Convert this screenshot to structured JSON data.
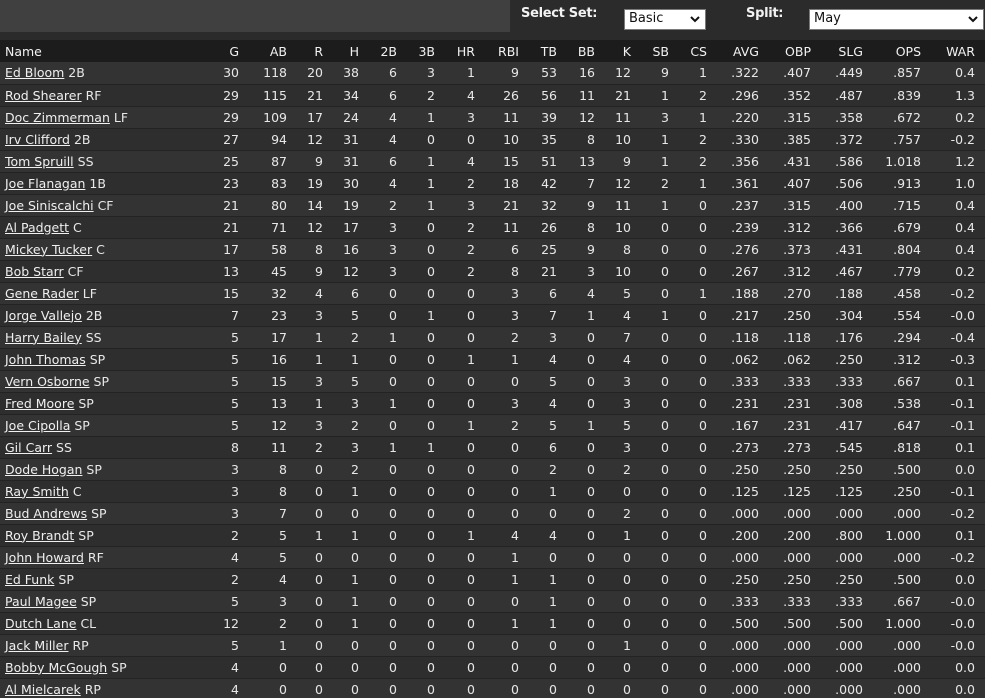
{
  "controls": {
    "select_set_label": "Select Set:",
    "select_set_value": "Basic",
    "split_label": "Split:",
    "split_value": "May"
  },
  "table": {
    "columns": [
      "Name",
      "G",
      "AB",
      "R",
      "H",
      "2B",
      "3B",
      "HR",
      "RBI",
      "TB",
      "BB",
      "K",
      "SB",
      "CS",
      "AVG",
      "OBP",
      "SLG",
      "OPS",
      "WAR"
    ],
    "rows": [
      {
        "name": "Ed Bloom",
        "pos": "2B",
        "stats": [
          "30",
          "118",
          "20",
          "38",
          "6",
          "3",
          "1",
          "9",
          "53",
          "16",
          "12",
          "9",
          "1",
          ".322",
          ".407",
          ".449",
          ".857",
          "0.4"
        ]
      },
      {
        "name": "Rod Shearer",
        "pos": "RF",
        "stats": [
          "29",
          "115",
          "21",
          "34",
          "6",
          "2",
          "4",
          "26",
          "56",
          "11",
          "21",
          "1",
          "2",
          ".296",
          ".352",
          ".487",
          ".839",
          "1.3"
        ]
      },
      {
        "name": "Doc Zimmerman",
        "pos": "LF",
        "stats": [
          "29",
          "109",
          "17",
          "24",
          "4",
          "1",
          "3",
          "11",
          "39",
          "12",
          "11",
          "3",
          "1",
          ".220",
          ".315",
          ".358",
          ".672",
          "0.2"
        ]
      },
      {
        "name": "Irv Clifford",
        "pos": "2B",
        "stats": [
          "27",
          "94",
          "12",
          "31",
          "4",
          "0",
          "0",
          "10",
          "35",
          "8",
          "10",
          "1",
          "2",
          ".330",
          ".385",
          ".372",
          ".757",
          "-0.2"
        ]
      },
      {
        "name": "Tom Spruill",
        "pos": "SS",
        "stats": [
          "25",
          "87",
          "9",
          "31",
          "6",
          "1",
          "4",
          "15",
          "51",
          "13",
          "9",
          "1",
          "2",
          ".356",
          ".431",
          ".586",
          "1.018",
          "1.2"
        ]
      },
      {
        "name": "Joe Flanagan",
        "pos": "1B",
        "stats": [
          "23",
          "83",
          "19",
          "30",
          "4",
          "1",
          "2",
          "18",
          "42",
          "7",
          "12",
          "2",
          "1",
          ".361",
          ".407",
          ".506",
          ".913",
          "1.0"
        ]
      },
      {
        "name": "Joe Siniscalchi",
        "pos": "CF",
        "stats": [
          "21",
          "80",
          "14",
          "19",
          "2",
          "1",
          "3",
          "21",
          "32",
          "9",
          "11",
          "1",
          "0",
          ".237",
          ".315",
          ".400",
          ".715",
          "0.4"
        ]
      },
      {
        "name": "Al Padgett",
        "pos": "C",
        "stats": [
          "21",
          "71",
          "12",
          "17",
          "3",
          "0",
          "2",
          "11",
          "26",
          "8",
          "10",
          "0",
          "0",
          ".239",
          ".312",
          ".366",
          ".679",
          "0.4"
        ]
      },
      {
        "name": "Mickey Tucker",
        "pos": "C",
        "stats": [
          "17",
          "58",
          "8",
          "16",
          "3",
          "0",
          "2",
          "6",
          "25",
          "9",
          "8",
          "0",
          "0",
          ".276",
          ".373",
          ".431",
          ".804",
          "0.4"
        ]
      },
      {
        "name": "Bob Starr",
        "pos": "CF",
        "stats": [
          "13",
          "45",
          "9",
          "12",
          "3",
          "0",
          "2",
          "8",
          "21",
          "3",
          "10",
          "0",
          "0",
          ".267",
          ".312",
          ".467",
          ".779",
          "0.2"
        ]
      },
      {
        "name": "Gene Rader",
        "pos": "LF",
        "stats": [
          "15",
          "32",
          "4",
          "6",
          "0",
          "0",
          "0",
          "3",
          "6",
          "4",
          "5",
          "0",
          "1",
          ".188",
          ".270",
          ".188",
          ".458",
          "-0.2"
        ]
      },
      {
        "name": "Jorge Vallejo",
        "pos": "2B",
        "stats": [
          "7",
          "23",
          "3",
          "5",
          "0",
          "1",
          "0",
          "3",
          "7",
          "1",
          "4",
          "1",
          "0",
          ".217",
          ".250",
          ".304",
          ".554",
          "-0.0"
        ]
      },
      {
        "name": "Harry Bailey",
        "pos": "SS",
        "stats": [
          "5",
          "17",
          "1",
          "2",
          "1",
          "0",
          "0",
          "2",
          "3",
          "0",
          "7",
          "0",
          "0",
          ".118",
          ".118",
          ".176",
          ".294",
          "-0.4"
        ]
      },
      {
        "name": "John Thomas",
        "pos": "SP",
        "stats": [
          "5",
          "16",
          "1",
          "1",
          "0",
          "0",
          "1",
          "1",
          "4",
          "0",
          "4",
          "0",
          "0",
          ".062",
          ".062",
          ".250",
          ".312",
          "-0.3"
        ]
      },
      {
        "name": "Vern Osborne",
        "pos": "SP",
        "stats": [
          "5",
          "15",
          "3",
          "5",
          "0",
          "0",
          "0",
          "0",
          "5",
          "0",
          "3",
          "0",
          "0",
          ".333",
          ".333",
          ".333",
          ".667",
          "0.1"
        ]
      },
      {
        "name": "Fred Moore",
        "pos": "SP",
        "stats": [
          "5",
          "13",
          "1",
          "3",
          "1",
          "0",
          "0",
          "3",
          "4",
          "0",
          "3",
          "0",
          "0",
          ".231",
          ".231",
          ".308",
          ".538",
          "-0.1"
        ]
      },
      {
        "name": "Joe Cipolla",
        "pos": "SP",
        "stats": [
          "5",
          "12",
          "3",
          "2",
          "0",
          "0",
          "1",
          "2",
          "5",
          "1",
          "5",
          "0",
          "0",
          ".167",
          ".231",
          ".417",
          ".647",
          "-0.1"
        ]
      },
      {
        "name": "Gil Carr",
        "pos": "SS",
        "stats": [
          "8",
          "11",
          "2",
          "3",
          "1",
          "1",
          "0",
          "0",
          "6",
          "0",
          "3",
          "0",
          "0",
          ".273",
          ".273",
          ".545",
          ".818",
          "0.1"
        ]
      },
      {
        "name": "Dode Hogan",
        "pos": "SP",
        "stats": [
          "3",
          "8",
          "0",
          "2",
          "0",
          "0",
          "0",
          "0",
          "2",
          "0",
          "2",
          "0",
          "0",
          ".250",
          ".250",
          ".250",
          ".500",
          "0.0"
        ]
      },
      {
        "name": "Ray Smith",
        "pos": "C",
        "stats": [
          "3",
          "8",
          "0",
          "1",
          "0",
          "0",
          "0",
          "0",
          "1",
          "0",
          "0",
          "0",
          "0",
          ".125",
          ".125",
          ".125",
          ".250",
          "-0.1"
        ]
      },
      {
        "name": "Bud Andrews",
        "pos": "SP",
        "stats": [
          "3",
          "7",
          "0",
          "0",
          "0",
          "0",
          "0",
          "0",
          "0",
          "0",
          "2",
          "0",
          "0",
          ".000",
          ".000",
          ".000",
          ".000",
          "-0.2"
        ]
      },
      {
        "name": "Roy Brandt",
        "pos": "SP",
        "stats": [
          "2",
          "5",
          "1",
          "1",
          "0",
          "0",
          "1",
          "4",
          "4",
          "0",
          "1",
          "0",
          "0",
          ".200",
          ".200",
          ".800",
          "1.000",
          "0.1"
        ]
      },
      {
        "name": "John Howard",
        "pos": "RF",
        "stats": [
          "4",
          "5",
          "0",
          "0",
          "0",
          "0",
          "0",
          "1",
          "0",
          "0",
          "0",
          "0",
          "0",
          ".000",
          ".000",
          ".000",
          ".000",
          "-0.2"
        ]
      },
      {
        "name": "Ed Funk",
        "pos": "SP",
        "stats": [
          "2",
          "4",
          "0",
          "1",
          "0",
          "0",
          "0",
          "1",
          "1",
          "0",
          "0",
          "0",
          "0",
          ".250",
          ".250",
          ".250",
          ".500",
          "0.0"
        ]
      },
      {
        "name": "Paul Magee",
        "pos": "SP",
        "stats": [
          "5",
          "3",
          "0",
          "1",
          "0",
          "0",
          "0",
          "0",
          "1",
          "0",
          "0",
          "0",
          "0",
          ".333",
          ".333",
          ".333",
          ".667",
          "-0.0"
        ]
      },
      {
        "name": "Dutch Lane",
        "pos": "CL",
        "stats": [
          "12",
          "2",
          "0",
          "1",
          "0",
          "0",
          "0",
          "1",
          "1",
          "0",
          "0",
          "0",
          "0",
          ".500",
          ".500",
          ".500",
          "1.000",
          "-0.0"
        ]
      },
      {
        "name": "Jack Miller",
        "pos": "RP",
        "stats": [
          "5",
          "1",
          "0",
          "0",
          "0",
          "0",
          "0",
          "0",
          "0",
          "0",
          "1",
          "0",
          "0",
          ".000",
          ".000",
          ".000",
          ".000",
          "-0.0"
        ]
      },
      {
        "name": "Bobby McGough",
        "pos": "SP",
        "stats": [
          "4",
          "0",
          "0",
          "0",
          "0",
          "0",
          "0",
          "0",
          "0",
          "0",
          "0",
          "0",
          "0",
          ".000",
          ".000",
          ".000",
          ".000",
          "0.0"
        ]
      },
      {
        "name": "Al Mielcarek",
        "pos": "RP",
        "stats": [
          "4",
          "0",
          "0",
          "0",
          "0",
          "0",
          "0",
          "0",
          "0",
          "0",
          "0",
          "0",
          "0",
          ".000",
          ".000",
          ".000",
          ".000",
          "0.0"
        ]
      }
    ]
  }
}
